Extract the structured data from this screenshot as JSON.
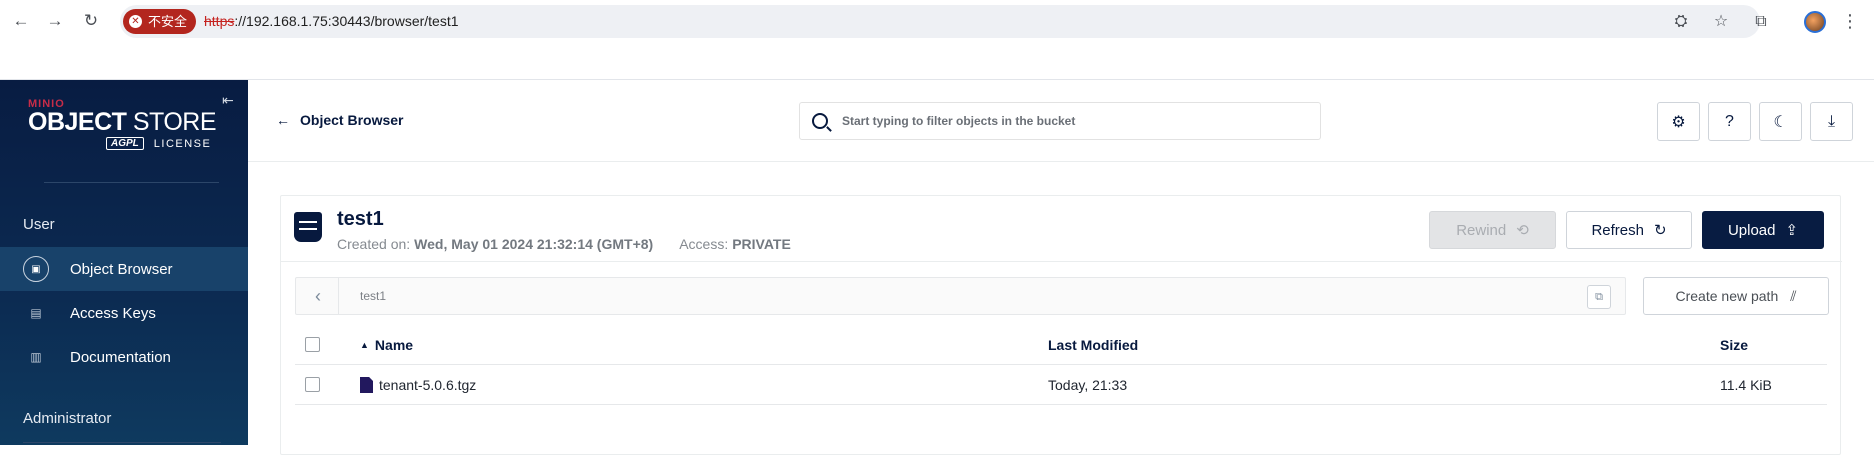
{
  "browser": {
    "security_label": "不安全",
    "url_scheme": "https",
    "url_rest": "://192.168.1.75:30443/browser/test1"
  },
  "sidebar": {
    "brand_minio": "MINIO",
    "brand_object": "OBJECT",
    "brand_store": "STORE",
    "brand_agpl": "AGPL",
    "brand_license": "LICENSE",
    "section_user": "User",
    "items": [
      {
        "label": "Object Browser",
        "icon": "object-browser-icon",
        "active": true
      },
      {
        "label": "Access Keys",
        "icon": "access-keys-icon",
        "active": false
      },
      {
        "label": "Documentation",
        "icon": "documentation-icon",
        "active": false
      }
    ],
    "section_admin": "Administrator"
  },
  "header": {
    "back_label": "Object Browser",
    "search_placeholder": "Start typing to filter objects in the bucket"
  },
  "bucket": {
    "name": "test1",
    "created_label": "Created on:",
    "created_value": "Wed, May 01 2024 21:32:14 (GMT+8)",
    "access_label": "Access:",
    "access_value": "PRIVATE",
    "rewind_label": "Rewind",
    "refresh_label": "Refresh",
    "upload_label": "Upload",
    "path": "test1",
    "create_path_label": "Create new path"
  },
  "table": {
    "headers": {
      "name": "Name",
      "modified": "Last Modified",
      "size": "Size"
    },
    "rows": [
      {
        "name": "tenant-5.0.6.tgz",
        "modified": "Today, 21:33",
        "size": "11.4 KiB"
      }
    ]
  },
  "colors": {
    "sidebar_bg": "#081c42",
    "accent": "#c72c48",
    "primary_button": "#081c42"
  }
}
